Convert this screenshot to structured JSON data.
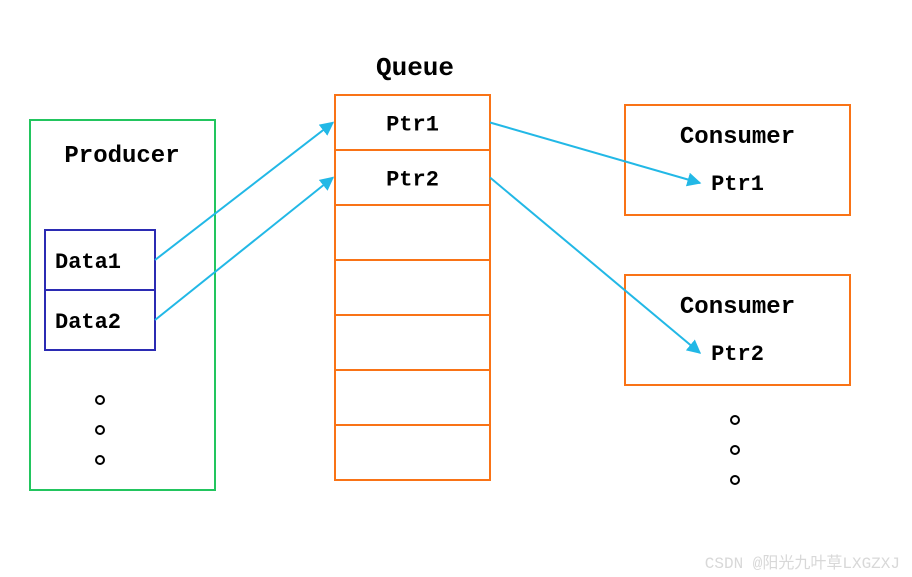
{
  "title": "Queue",
  "producer": {
    "label": "Producer",
    "items": [
      "Data1",
      "Data2"
    ]
  },
  "queue": {
    "items": [
      "Ptr1",
      "Ptr2",
      "",
      "",
      "",
      "",
      ""
    ]
  },
  "consumers": [
    {
      "label": "Consumer",
      "ptr": "Ptr1"
    },
    {
      "label": "Consumer",
      "ptr": "Ptr2"
    }
  ],
  "watermark": "CSDN @阳光九叶草LXGZXJ",
  "colors": {
    "green": "#22c55e",
    "blue": "#2b2bb3",
    "orange": "#f97316",
    "cyan": "#22b8e6",
    "text": "#000000",
    "wm": "#d8d8d8"
  }
}
